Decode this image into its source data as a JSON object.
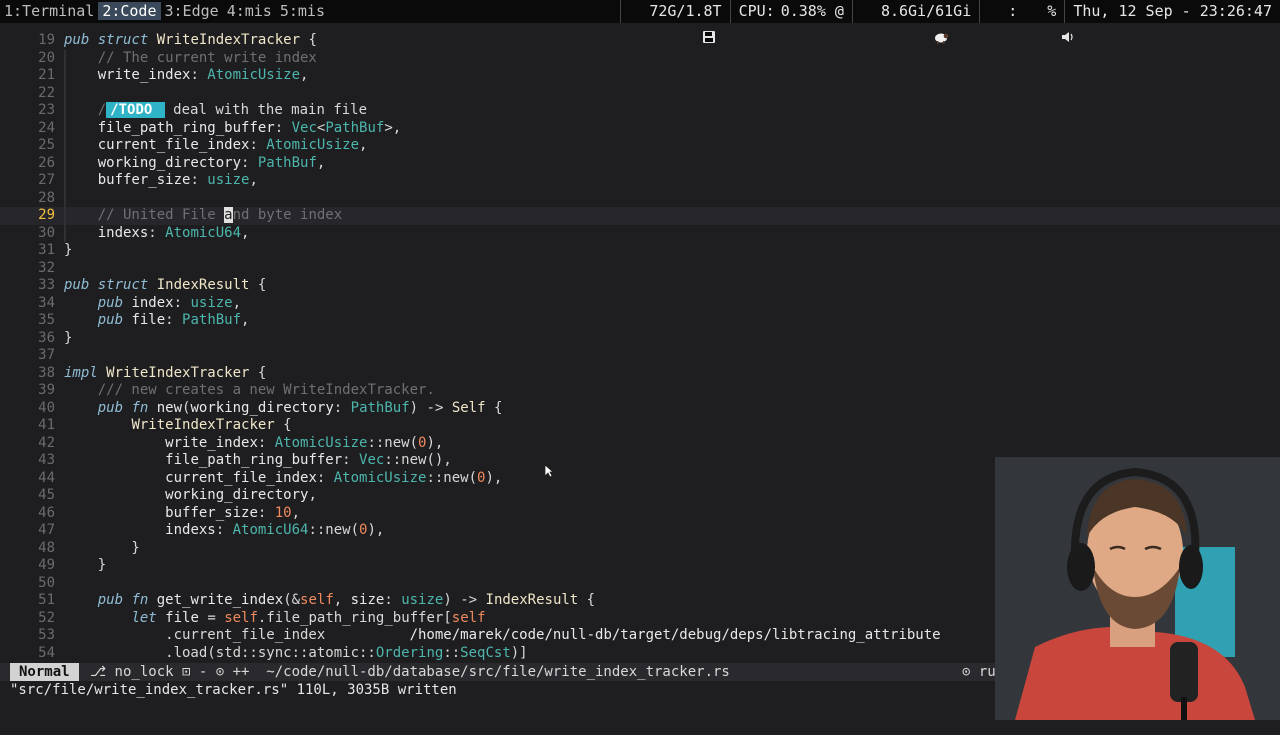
{
  "topbar": {
    "workspaces": [
      "1:Terminal",
      "2:Code",
      "3:Edge",
      "4:mis",
      "5:mis"
    ],
    "active_workspace": 1,
    "disk": "72G/1.8T",
    "cpu_label": "CPU:",
    "cpu_value": "0.38% @",
    "mem": "8.6Gi/61Gi",
    "volume_label": ":",
    "volume_value": "%",
    "clock": "Thu, 12 Sep - 23:26:47",
    "icons": [
      "save-disk-icon",
      "memory-sheep-icon",
      "speaker-icon"
    ]
  },
  "editor": {
    "cursor_line": "29",
    "lines": [
      {
        "n": "19",
        "t": [
          [
            "pub",
            "kw"
          ],
          [
            " "
          ],
          [
            "struct",
            "kw"
          ],
          [
            " "
          ],
          [
            "WriteIndexTracker",
            "ty"
          ],
          [
            " {"
          ]
        ]
      },
      {
        "n": "20",
        "t": [
          [
            "    "
          ],
          [
            "// The current write index",
            "cm"
          ]
        ]
      },
      {
        "n": "21",
        "t": [
          [
            "    "
          ],
          [
            "write_index",
            "fld"
          ],
          [
            ": "
          ],
          [
            "AtomicUsize",
            "tyb"
          ],
          [
            ","
          ]
        ]
      },
      {
        "n": "22",
        "t": []
      },
      {
        "n": "23",
        "t": [
          [
            "    "
          ],
          [
            "/",
            "cm"
          ],
          [
            "/TODO ",
            "todo"
          ],
          [
            " "
          ],
          [
            "deal with the main file",
            "cm2"
          ]
        ]
      },
      {
        "n": "24",
        "t": [
          [
            "    "
          ],
          [
            "file_path_ring_buffer",
            "fld"
          ],
          [
            ": "
          ],
          [
            "Vec",
            "tyb"
          ],
          [
            "<"
          ],
          [
            "PathBuf",
            "tyb"
          ],
          [
            ">,"
          ]
        ]
      },
      {
        "n": "25",
        "t": [
          [
            "    "
          ],
          [
            "current_file_index",
            "fld"
          ],
          [
            ": "
          ],
          [
            "AtomicUsize",
            "tyb"
          ],
          [
            ","
          ]
        ]
      },
      {
        "n": "26",
        "t": [
          [
            "    "
          ],
          [
            "working_directory",
            "fld"
          ],
          [
            ": "
          ],
          [
            "PathBuf",
            "tyb"
          ],
          [
            ","
          ]
        ]
      },
      {
        "n": "27",
        "t": [
          [
            "    "
          ],
          [
            "buffer_size",
            "fld"
          ],
          [
            ": "
          ],
          [
            "usize",
            "tyb"
          ],
          [
            ","
          ]
        ]
      },
      {
        "n": "28",
        "t": []
      },
      {
        "n": "29",
        "t": [
          [
            "    "
          ],
          [
            "// United File ",
            "cm"
          ],
          [
            "a",
            "cursor"
          ],
          [
            "nd byte index",
            "cm"
          ]
        ]
      },
      {
        "n": "30",
        "t": [
          [
            "    "
          ],
          [
            "indexs",
            "fld"
          ],
          [
            ": "
          ],
          [
            "AtomicU64",
            "tyb"
          ],
          [
            ","
          ]
        ]
      },
      {
        "n": "31",
        "t": [
          [
            "}"
          ]
        ]
      },
      {
        "n": "32",
        "t": []
      },
      {
        "n": "33",
        "t": [
          [
            "pub",
            "kw"
          ],
          [
            " "
          ],
          [
            "struct",
            "kw"
          ],
          [
            " "
          ],
          [
            "IndexResult",
            "ty"
          ],
          [
            " {"
          ]
        ]
      },
      {
        "n": "34",
        "t": [
          [
            "    "
          ],
          [
            "pub",
            "kw"
          ],
          [
            " "
          ],
          [
            "index",
            "fld"
          ],
          [
            ": "
          ],
          [
            "usize",
            "tyb"
          ],
          [
            ","
          ]
        ]
      },
      {
        "n": "35",
        "t": [
          [
            "    "
          ],
          [
            "pub",
            "kw"
          ],
          [
            " "
          ],
          [
            "file",
            "fld"
          ],
          [
            ": "
          ],
          [
            "PathBuf",
            "tyb"
          ],
          [
            ","
          ]
        ]
      },
      {
        "n": "36",
        "t": [
          [
            "}"
          ]
        ]
      },
      {
        "n": "37",
        "t": []
      },
      {
        "n": "38",
        "t": [
          [
            "impl",
            "kw"
          ],
          [
            " "
          ],
          [
            "WriteIndexTracker",
            "ty"
          ],
          [
            " {"
          ]
        ]
      },
      {
        "n": "39",
        "t": [
          [
            "    "
          ],
          [
            "/// new creates a new WriteIndexTracker.",
            "cm"
          ]
        ]
      },
      {
        "n": "40",
        "t": [
          [
            "    "
          ],
          [
            "pub",
            "kw"
          ],
          [
            " "
          ],
          [
            "fn",
            "kw"
          ],
          [
            " "
          ],
          [
            "new",
            "fld"
          ],
          [
            "("
          ],
          [
            "working_directory",
            "fld"
          ],
          [
            ": "
          ],
          [
            "PathBuf",
            "tyb"
          ],
          [
            ") -> "
          ],
          [
            "Self",
            "ty"
          ],
          [
            " {"
          ]
        ]
      },
      {
        "n": "41",
        "t": [
          [
            "        "
          ],
          [
            "WriteIndexTracker",
            "ty"
          ],
          [
            " {"
          ]
        ]
      },
      {
        "n": "42",
        "t": [
          [
            "            "
          ],
          [
            "write_index",
            "fld"
          ],
          [
            ": "
          ],
          [
            "AtomicUsize",
            "tyb"
          ],
          [
            "::new("
          ],
          [
            "0",
            "num"
          ],
          [
            "),"
          ]
        ]
      },
      {
        "n": "43",
        "t": [
          [
            "            "
          ],
          [
            "file_path_ring_buffer",
            "fld"
          ],
          [
            ": "
          ],
          [
            "Vec",
            "tyb"
          ],
          [
            "::new(),"
          ]
        ]
      },
      {
        "n": "44",
        "t": [
          [
            "            "
          ],
          [
            "current_file_index",
            "fld"
          ],
          [
            ": "
          ],
          [
            "AtomicUsize",
            "tyb"
          ],
          [
            "::new("
          ],
          [
            "0",
            "num"
          ],
          [
            "),"
          ]
        ]
      },
      {
        "n": "45",
        "t": [
          [
            "            "
          ],
          [
            "working_directory",
            "fld"
          ],
          [
            ","
          ]
        ]
      },
      {
        "n": "46",
        "t": [
          [
            "            "
          ],
          [
            "buffer_size",
            "fld"
          ],
          [
            ": "
          ],
          [
            "10",
            "num"
          ],
          [
            ","
          ]
        ]
      },
      {
        "n": "47",
        "t": [
          [
            "            "
          ],
          [
            "indexs",
            "fld"
          ],
          [
            ": "
          ],
          [
            "AtomicU64",
            "tyb"
          ],
          [
            "::new("
          ],
          [
            "0",
            "num"
          ],
          [
            "),"
          ]
        ]
      },
      {
        "n": "48",
        "t": [
          [
            "        }"
          ]
        ]
      },
      {
        "n": "49",
        "t": [
          [
            "    }"
          ]
        ]
      },
      {
        "n": "50",
        "t": []
      },
      {
        "n": "51",
        "t": [
          [
            "    "
          ],
          [
            "pub",
            "kw"
          ],
          [
            " "
          ],
          [
            "fn",
            "kw"
          ],
          [
            " "
          ],
          [
            "get_write_index",
            "fld"
          ],
          [
            "(&"
          ],
          [
            "self",
            "num"
          ],
          [
            ", "
          ],
          [
            "size",
            "fld"
          ],
          [
            ": "
          ],
          [
            "usize",
            "tyb"
          ],
          [
            ") -> "
          ],
          [
            "IndexResult",
            "ty"
          ],
          [
            " {"
          ]
        ]
      },
      {
        "n": "52",
        "t": [
          [
            "        "
          ],
          [
            "let",
            "kw"
          ],
          [
            " "
          ],
          [
            "file",
            "fld"
          ],
          [
            " = "
          ],
          [
            "self",
            "num"
          ],
          [
            ".file_path_ring_buffer["
          ],
          [
            "self",
            "num"
          ]
        ]
      },
      {
        "n": "53",
        "t": [
          [
            "            .current_file_index          "
          ],
          [
            "/home/marek/code/null-db/target/debug/deps/libtracing_attribute",
            "fld"
          ]
        ]
      },
      {
        "n": "54",
        "t": [
          [
            "            .load(std::sync::atomic::"
          ],
          [
            "Ordering",
            "tyb"
          ],
          [
            "::"
          ],
          [
            "SeqCst",
            "tyb"
          ],
          [
            ")]"
          ]
        ]
      }
    ]
  },
  "statusline": {
    "mode": "Normal",
    "branch": " no_lock",
    "info": "⎇ no_lock ⊡ - ⊙ ++  ~/code/null-db/database/src/file/write_index_tracker.rs",
    "right": "⊙ ru"
  },
  "cmdline": "\"src/file/write_index_tracker.rs\" 110L, 3035B written"
}
